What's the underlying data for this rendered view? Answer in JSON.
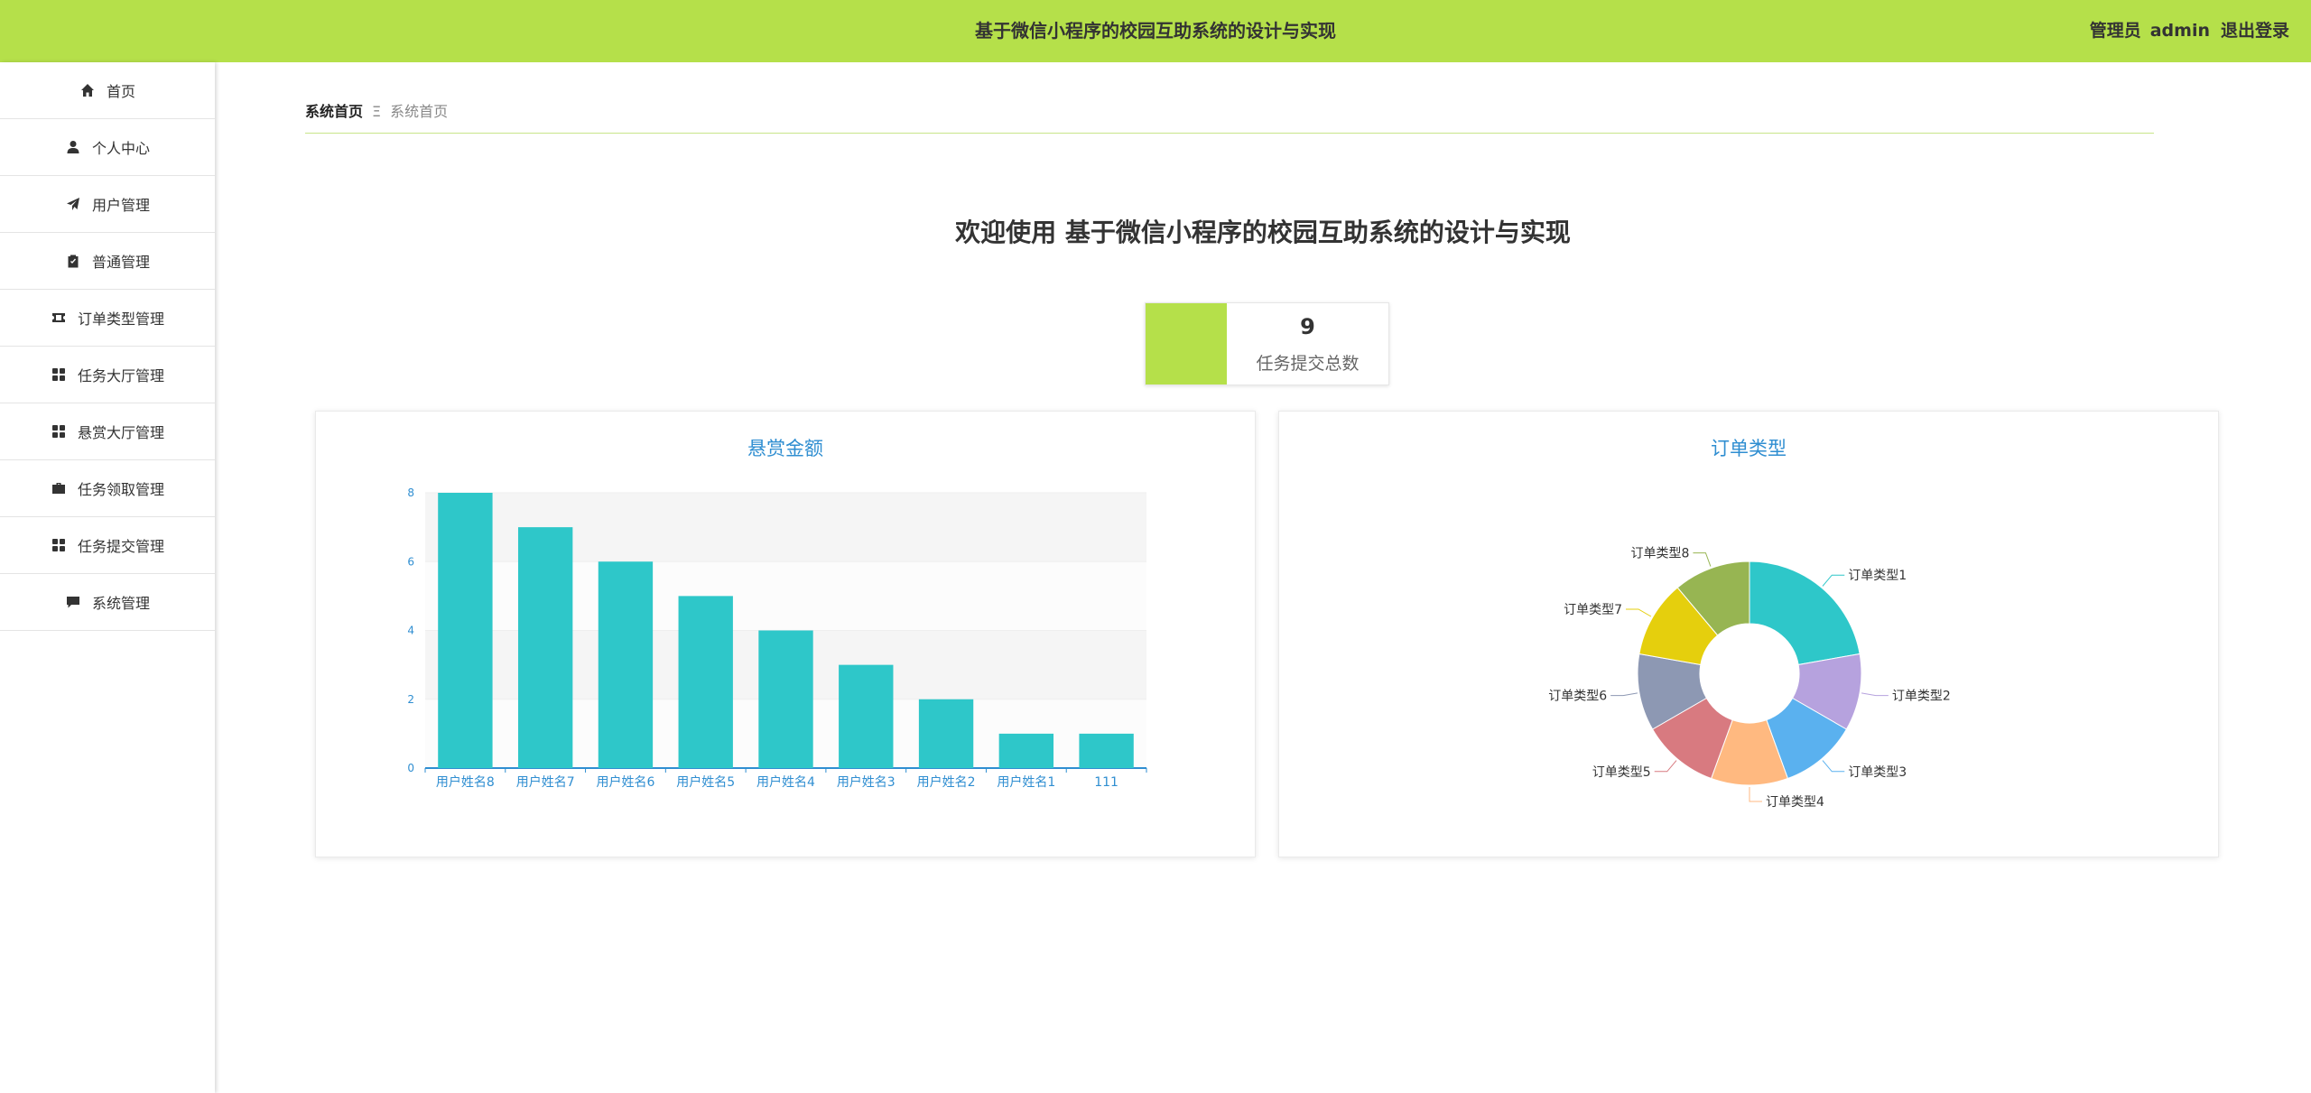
{
  "header": {
    "title": "基于微信小程序的校园互助系统的设计与实现",
    "role_label": "管理员",
    "username": "admin",
    "logout_label": "退出登录",
    "accent_color": "#b5e04a"
  },
  "sidebar": {
    "items": [
      {
        "label": "首页",
        "icon": "home-icon"
      },
      {
        "label": "个人中心",
        "icon": "user-icon"
      },
      {
        "label": "用户管理",
        "icon": "paper-plane-icon"
      },
      {
        "label": "普通管理",
        "icon": "clipboard-icon"
      },
      {
        "label": "订单类型管理",
        "icon": "ticket-icon"
      },
      {
        "label": "任务大厅管理",
        "icon": "grid-icon"
      },
      {
        "label": "悬赏大厅管理",
        "icon": "grid-icon"
      },
      {
        "label": "任务领取管理",
        "icon": "briefcase-icon"
      },
      {
        "label": "任务提交管理",
        "icon": "grid-icon"
      },
      {
        "label": "系统管理",
        "icon": "chat-icon"
      }
    ]
  },
  "breadcrumb": {
    "home": "系统首页",
    "separator": "Ξ",
    "current": "系统首页"
  },
  "welcome": "欢迎使用 基于微信小程序的校园互助系统的设计与实现",
  "stat": {
    "value": "9",
    "label": "任务提交总数"
  },
  "chart_data": [
    {
      "type": "bar",
      "title": "悬赏金额",
      "categories": [
        "用户姓名8",
        "用户姓名7",
        "用户姓名6",
        "用户姓名5",
        "用户姓名4",
        "用户姓名3",
        "用户姓名2",
        "用户姓名1",
        "111"
      ],
      "values": [
        8,
        7,
        6,
        5,
        4,
        3,
        2,
        1,
        1
      ],
      "ylim": [
        0,
        8
      ],
      "yticks": [
        0,
        2,
        4,
        6,
        8
      ],
      "bar_color": "#2ec7c9",
      "grid": true
    },
    {
      "type": "pie",
      "title": "订单类型",
      "donut": true,
      "categories": [
        "订单类型1",
        "订单类型2",
        "订单类型3",
        "订单类型4",
        "订单类型5",
        "订单类型6",
        "订单类型7",
        "订单类型8"
      ],
      "values": [
        10,
        5,
        5,
        5,
        5,
        5,
        5,
        5
      ],
      "colors": [
        "#2ec7c9",
        "#b6a2de",
        "#5ab1ef",
        "#ffb980",
        "#d87a80",
        "#8d98b3",
        "#e5cf0d",
        "#97b552"
      ]
    }
  ]
}
